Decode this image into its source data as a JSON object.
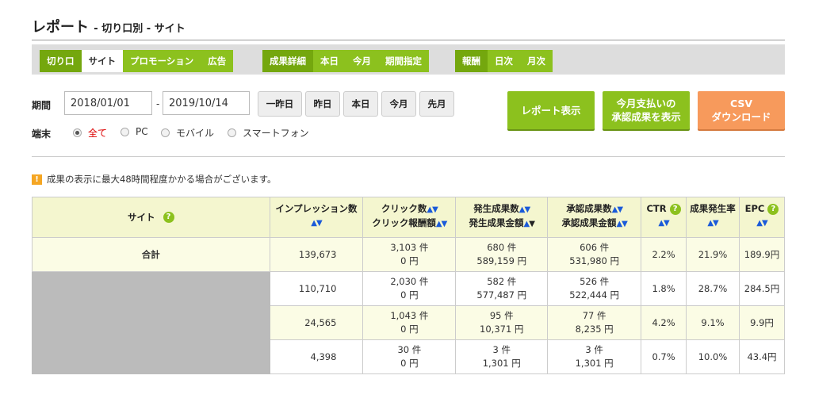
{
  "page": {
    "title": "レポート",
    "subtitle": "- 切り口別 - サイト"
  },
  "tabs": {
    "group1": [
      {
        "label": "切り口",
        "state": "dark"
      },
      {
        "label": "サイト",
        "state": "active"
      },
      {
        "label": "プロモーション",
        "state": "normal"
      },
      {
        "label": "広告",
        "state": "normal"
      }
    ],
    "group2": [
      {
        "label": "成果詳細",
        "state": "dark"
      },
      {
        "label": "本日",
        "state": "normal"
      },
      {
        "label": "今月",
        "state": "normal"
      },
      {
        "label": "期間指定",
        "state": "normal"
      }
    ],
    "group3": [
      {
        "label": "報酬",
        "state": "dark"
      },
      {
        "label": "日次",
        "state": "normal"
      },
      {
        "label": "月次",
        "state": "normal"
      }
    ]
  },
  "filters": {
    "period_label": "期間",
    "start_date": "2018/01/01",
    "separator": "-",
    "end_date": "2019/10/14",
    "quick": [
      "一昨日",
      "昨日",
      "本日",
      "今月",
      "先月"
    ],
    "device_label": "端末",
    "devices": [
      {
        "label": "全て",
        "selected": true
      },
      {
        "label": "PC",
        "selected": false
      },
      {
        "label": "モバイル",
        "selected": false
      },
      {
        "label": "スマートフォン",
        "selected": false
      }
    ]
  },
  "actions": {
    "report_button": "レポート表示",
    "approved_line1": "今月支払いの",
    "approved_line2": "承認成果を表示",
    "csv_line1": "CSV",
    "csv_line2": "ダウンロード"
  },
  "notice": "成果の表示に最大48時間程度かかる場合がございます。",
  "table": {
    "headers": {
      "site": "サイト",
      "impressions": "インプレッション数",
      "clicks": "クリック数",
      "click_reward": "クリック報酬額",
      "occurred_count": "発生成果数",
      "occurred_amount": "発生成果金額",
      "approved_count": "承認成果数",
      "approved_amount": "承認成果金額",
      "ctr": "CTR",
      "cvr": "成果発生率",
      "epc": "EPC"
    },
    "sort_arrows": "▲▼",
    "help_icon": "?",
    "total": {
      "label": "合計",
      "impressions": "139,673",
      "clicks": "3,103 件",
      "click_reward": "0 円",
      "occurred_count": "680 件",
      "occurred_amount": "589,159 円",
      "approved_count": "606 件",
      "approved_amount": "531,980 円",
      "ctr": "2.2%",
      "cvr": "21.9%",
      "epc": "189.9円"
    },
    "rows": [
      {
        "impressions": "110,710",
        "clicks": "2,030 件",
        "click_reward": "0 円",
        "occurred_count": "582 件",
        "occurred_amount": "577,487 円",
        "approved_count": "526 件",
        "approved_amount": "522,444 円",
        "ctr": "1.8%",
        "cvr": "28.7%",
        "epc": "284.5円"
      },
      {
        "impressions": "24,565",
        "clicks": "1,043 件",
        "click_reward": "0 円",
        "occurred_count": "95 件",
        "occurred_amount": "10,371 円",
        "approved_count": "77 件",
        "approved_amount": "8,235 円",
        "ctr": "4.2%",
        "cvr": "9.1%",
        "epc": "9.9円"
      },
      {
        "impressions": "4,398",
        "clicks": "30 件",
        "click_reward": "0 円",
        "occurred_count": "3 件",
        "occurred_amount": "1,301 円",
        "approved_count": "3 件",
        "approved_amount": "1,301 円",
        "ctr": "0.7%",
        "cvr": "10.0%",
        "epc": "43.4円"
      }
    ]
  },
  "colors": {
    "accent_green": "#8cc11e",
    "dark_green": "#74a70e",
    "csv_orange": "#f79a5c",
    "header_yellow": "#f4f6cf",
    "sort_blue": "#1a5ad9"
  }
}
